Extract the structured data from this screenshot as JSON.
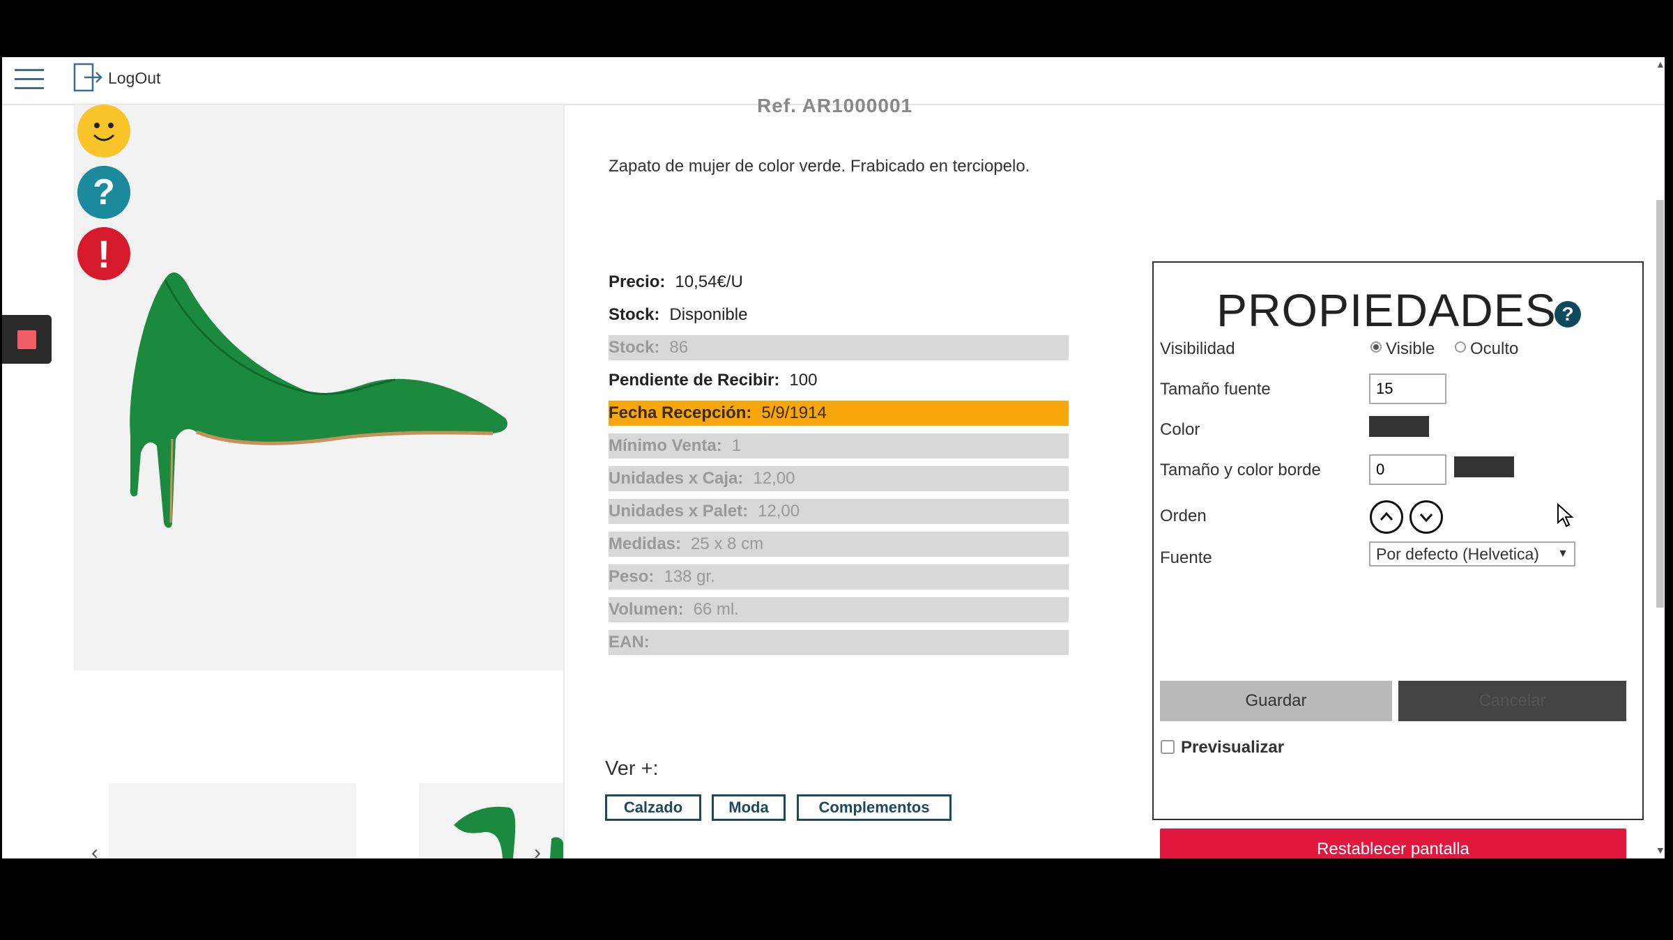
{
  "header": {
    "logout_label": "LogOut"
  },
  "icons": {
    "smile": "smile-icon",
    "help": "help-icon",
    "alert": "alert-icon",
    "stop": "stop-icon"
  },
  "product": {
    "ref": "Ref. AR1000001",
    "description": "Zapato de mujer de color verde. Frabicado en terciopelo.",
    "rows": [
      {
        "label": "Precio:",
        "value": "10,54€/U",
        "style": "normal"
      },
      {
        "label": "Stock:",
        "value": "Disponible",
        "style": "normal"
      },
      {
        "label": "Stock:",
        "value": "86",
        "style": "grey"
      },
      {
        "label": "Pendiente de Recibir:",
        "value": "100",
        "style": "normal"
      },
      {
        "label": "Fecha Recepción:",
        "value": "5/9/1914",
        "style": "orange"
      },
      {
        "label": "Mínimo Venta:",
        "value": "1",
        "style": "grey"
      },
      {
        "label": "Unidades x Caja:",
        "value": "12,00",
        "style": "grey"
      },
      {
        "label": "Unidades x Palet:",
        "value": "12,00",
        "style": "grey"
      },
      {
        "label": "Medidas:",
        "value": "25 x 8 cm",
        "style": "grey"
      },
      {
        "label": "Peso:",
        "value": "138 gr.",
        "style": "grey"
      },
      {
        "label": "Volumen:",
        "value": "66 ml.",
        "style": "grey"
      },
      {
        "label": "EAN:",
        "value": "",
        "style": "grey"
      }
    ],
    "ver_label": "Ver +:",
    "tags": [
      "Calzado",
      "Moda",
      "Complementos"
    ]
  },
  "panel": {
    "title": "PROPIEDADES",
    "help_glyph": "?",
    "visibility_label": "Visibilidad",
    "visible_label": "Visible",
    "hidden_label": "Oculto",
    "visibility_selected": "Visible",
    "font_size_label": "Tamaño fuente",
    "font_size_value": "15",
    "color_label": "Color",
    "color_value": "#333333",
    "border_label": "Tamaño y color borde",
    "border_value": "0",
    "border_color": "#333333",
    "order_label": "Orden",
    "font_label": "Fuente",
    "font_value": "Por defecto (Helvetica)",
    "save_label": "Guardar",
    "cancel_label": "Cancelar",
    "preview_label": "Previsualizar",
    "preview_checked": false,
    "reset_label": "Restablecer pantalla"
  },
  "colors": {
    "accent_orange": "#f7a70a",
    "reset_red": "#e0173f",
    "tag_border": "#1c4a5c",
    "shoe_green": "#1b8a3e"
  }
}
